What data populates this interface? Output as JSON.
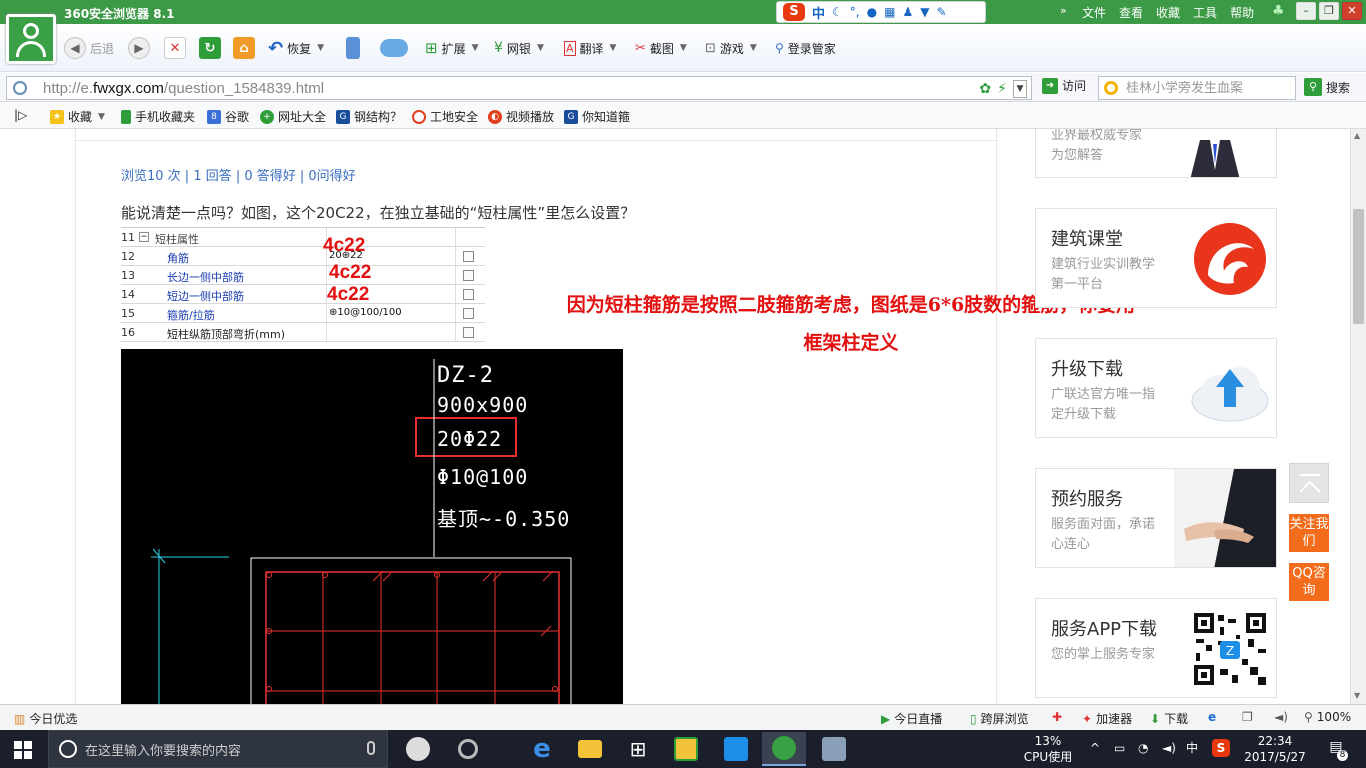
{
  "titlebar": {
    "app_title": "360安全浏览器 8.1",
    "ime": {
      "logo": "S",
      "mode": "中"
    },
    "menu": [
      "文件",
      "查看",
      "收藏",
      "工具",
      "帮助"
    ]
  },
  "toolbar": {
    "back": "后退",
    "restore": "恢复",
    "items": [
      "扩展",
      "网银",
      "翻译",
      "截图",
      "游戏",
      "登录管家"
    ]
  },
  "address": {
    "url_prefix": "http://e.",
    "url_domain": "fwxgx.com",
    "url_path": "/question_1584839.html",
    "go_label": "访问",
    "search_placeholder": "桂林小学旁发生血案",
    "search_label": "搜索"
  },
  "bookmarks": [
    "收藏",
    "手机收藏夹",
    "谷歌",
    "网址大全",
    "钢结构？",
    "工地安全",
    "视频播放",
    "你知道箍"
  ],
  "page": {
    "stats": "浏览10 次 | 1 回答 | 0 答得好 | 0问得好",
    "question": "能说清楚一点吗？如图，这个20C22，在独立基础的“短柱属性”里怎么设置？",
    "table": {
      "rows": [
        {
          "num": "11",
          "label": "短柱属性",
          "value": ""
        },
        {
          "num": "12",
          "label": "角筋",
          "value": "20⊕22"
        },
        {
          "num": "13",
          "label": "长边一侧中部筋",
          "value": ""
        },
        {
          "num": "14",
          "label": "短边一侧中部筋",
          "value": ""
        },
        {
          "num": "15",
          "label": "箍筋/拉筋",
          "value": "⊕10@100/100"
        },
        {
          "num": "16",
          "label": "短柱纵筋顶部弯折(mm)",
          "value": ""
        }
      ]
    },
    "annotations": [
      "4c22",
      "4c22",
      "4c22"
    ],
    "cad": {
      "lines": [
        "DZ-2",
        "900x900",
        "20Φ22",
        "Φ10@100",
        "基顶~-0.350"
      ]
    },
    "answer_line1": "因为短柱箍筋是按照二肢箍筋考虑，图纸是6*6肢数的箍筋，你要用",
    "answer_line2": "框架柱定义"
  },
  "sidebar": {
    "partial_card_text": [
      "业界最权威专家",
      "为您解答"
    ],
    "cards": [
      {
        "title": "建筑课堂",
        "desc": "建筑行业实训教学第一平台",
        "icon": "building-class-logo"
      },
      {
        "title": "升级下载",
        "desc": "广联达官方唯一指定升级下载",
        "icon": "cloud-upload-icon"
      },
      {
        "title": "预约服务",
        "desc": "服务面对面，承诺心连心",
        "icon": "handshake-photo"
      },
      {
        "title": "服务APP下载",
        "desc": "您的掌上服务专家",
        "icon": "qr-code"
      }
    ],
    "follow_label": "关注我们",
    "qq_label": "QQ咨询"
  },
  "statusbar": {
    "left": "今日优选",
    "items": [
      "今日直播",
      "跨屏浏览",
      "加速器",
      "下载"
    ],
    "zoom": "100%"
  },
  "taskbar": {
    "search_placeholder": "在这里输入你要搜索的内容",
    "cpu_percent": "13%",
    "cpu_label": "CPU使用",
    "ime": "中",
    "time": "22:34",
    "date": "2017/5/27",
    "notifications": "8"
  },
  "colors": {
    "browser_green": "#3c9a46",
    "annotation_red": "#e31010",
    "link_blue": "#3a6fbf",
    "orange": "#f26c1c"
  }
}
